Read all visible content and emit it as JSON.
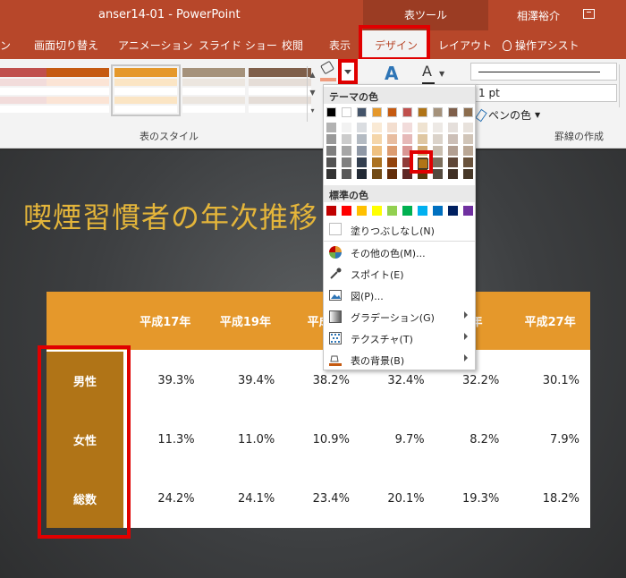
{
  "titlebar": {
    "doc_title": "anser14-01 - PowerPoint",
    "tools_tab": "表ツール",
    "user_name": "相澤裕介"
  },
  "tabs": {
    "partial": "ン",
    "transitions": "画面切り替え",
    "animations": "アニメーション",
    "slideshow": "スライド ショー",
    "review": "校閲",
    "view": "表示",
    "design": "デザイン",
    "layout": "レイアウト",
    "tell_me": "操作アシスト"
  },
  "ribbon": {
    "table_styles_label": "表のスタイル",
    "line_weight": "1 pt",
    "pen_color": "ペンの色",
    "draw_borders_label": "罫線の作成",
    "font_color_glyph": "A",
    "text_effect_glyph": "A"
  },
  "slide": {
    "title": "喫煙習慣者の年次推移"
  },
  "table": {
    "headers": [
      "",
      "平成17年",
      "平成19年",
      "平成2",
      "",
      "6年",
      "平成27年"
    ],
    "rows": [
      {
        "label": "男性",
        "values": [
          "39.3%",
          "39.4%",
          "38.2%",
          "32.4%",
          "32.2%",
          "30.1%"
        ]
      },
      {
        "label": "女性",
        "values": [
          "11.3%",
          "11.0%",
          "10.9%",
          "9.7%",
          "8.2%",
          "7.9%"
        ]
      },
      {
        "label": "総数",
        "values": [
          "24.2%",
          "24.1%",
          "23.4%",
          "20.1%",
          "19.3%",
          "18.2%"
        ]
      }
    ]
  },
  "menu": {
    "theme_colors_head": "テーマの色",
    "standard_colors_head": "標準の色",
    "no_fill": "塗りつぶしなし(N)",
    "more_colors": "その他の色(M)...",
    "eyedropper": "スポイト(E)",
    "picture": "図(P)...",
    "gradient": "グラデーション(G)",
    "texture": "テクスチャ(T)",
    "table_background": "表の背景(B)"
  },
  "colors": {
    "accent": "#b7472a",
    "highlight": "#e00000",
    "header_fill": "#e5982b",
    "rowhead_fill": "#b07417",
    "title_text": "#e4b53a",
    "theme_top": [
      "#000000",
      "#ffffff",
      "#44546a",
      "#e5982b",
      "#c55a11",
      "#c0504d",
      "#b07417",
      "#a5927b",
      "#7f5f4a",
      "#8c6d4e"
    ],
    "standard": [
      "#c00000",
      "#ff0000",
      "#ffc000",
      "#ffff00",
      "#92d050",
      "#00b050",
      "#00b0f0",
      "#0070c0",
      "#002060",
      "#7030a0"
    ]
  }
}
